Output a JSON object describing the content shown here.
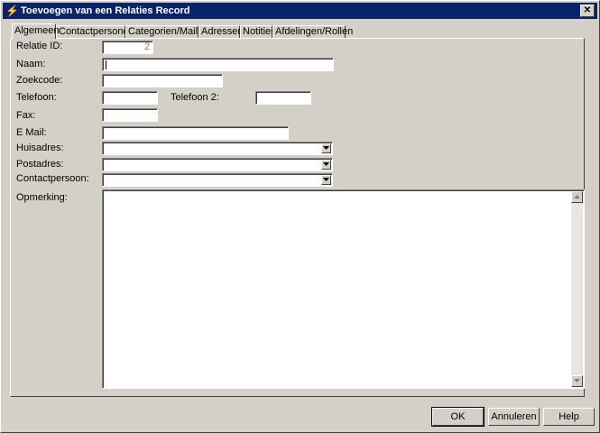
{
  "window": {
    "title": "Toevoegen van een Relaties Record",
    "close_glyph": "✕"
  },
  "tabs": [
    {
      "label": "Algemeen",
      "active": true
    },
    {
      "label": "Contactpersonen",
      "active": false
    },
    {
      "label": "Categorien/Mailing",
      "active": false
    },
    {
      "label": "Adressen",
      "active": false
    },
    {
      "label": "Notities",
      "active": false
    },
    {
      "label": "Afdelingen/Rollen",
      "active": false
    }
  ],
  "form": {
    "relatie_id": {
      "label": "Relatie ID:",
      "value": "2"
    },
    "naam": {
      "label": "Naam:",
      "value": ""
    },
    "zoekcode": {
      "label": "Zoekcode:",
      "value": ""
    },
    "telefoon": {
      "label": "Telefoon:",
      "value": ""
    },
    "telefoon2": {
      "label": "Telefoon 2:",
      "value": ""
    },
    "fax": {
      "label": "Fax:",
      "value": ""
    },
    "email": {
      "label": "E Mail:",
      "value": ""
    },
    "huisadres": {
      "label": "Huisadres:",
      "value": ""
    },
    "postadres": {
      "label": "Postadres:",
      "value": ""
    },
    "contactpersoon": {
      "label": "Contactpersoon:",
      "value": ""
    },
    "opmerking": {
      "label": "Opmerking:",
      "value": ""
    }
  },
  "buttons": {
    "ok": "OK",
    "cancel": "Annuleren",
    "help": "Help"
  },
  "colors": {
    "titlebar": "#0a246a",
    "face": "#d4d0c8"
  }
}
